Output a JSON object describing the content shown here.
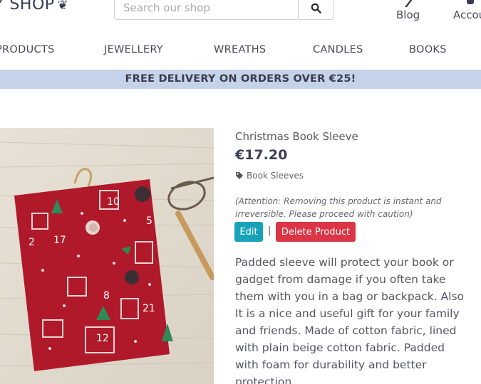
{
  "header": {
    "logo_text": "Y SHOP",
    "search_placeholder": "Search our shop",
    "blog_label": "Blog",
    "account_label": "Accou"
  },
  "categories": [
    "PRODUCTS",
    "JEWELLERY",
    "WREATHS",
    "CANDLES",
    "BOOKS"
  ],
  "banner": "FREE DELIVERY ON ORDERS OVER €25!",
  "product": {
    "title": "Christmas Book Sleeve",
    "price": "€17.20",
    "tag": "Book Sleeves",
    "warning": "(Attention: Removing this product is instant and irreversible. Please proceed with caution)",
    "edit_label": "Edit",
    "separator": "|",
    "delete_label": "Delete Product",
    "description": "Padded sleeve will protect your book or gadget from damage if you often take them with you in a bag or backpack. Also It is a nice and useful gift for your family and friends. Made of cotton fabric, lined with plain beige cotton fabric. Padded with foam for durability and better protection."
  },
  "colors": {
    "banner_bg": "#c4d3ea",
    "edit_button": "#17a2b8",
    "delete_button": "#dc3545",
    "sleeve_red": "#b0192a"
  }
}
